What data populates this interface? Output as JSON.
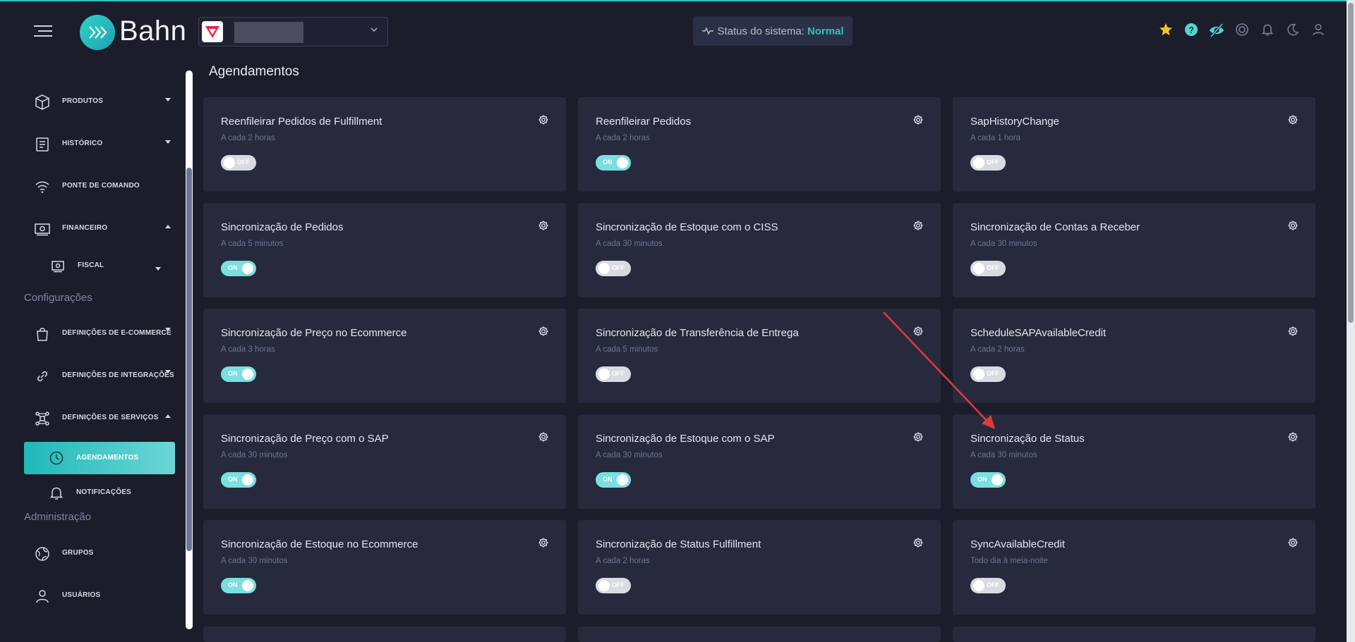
{
  "app": {
    "brand": "Bahn"
  },
  "header": {
    "status_label": "Status do sistema:",
    "status_value": "Normal",
    "icons": [
      "star-icon",
      "help-icon",
      "eye-off-icon",
      "support-icon",
      "bell-icon",
      "moon-icon",
      "user-icon"
    ],
    "colors": {
      "accent": "#2ec4b6",
      "star": "#f5c518"
    }
  },
  "sidebar": {
    "items": [
      {
        "label": "PRODUTOS",
        "icon": "box-icon",
        "caret": "down"
      },
      {
        "label": "HISTÓRICO",
        "icon": "document-icon",
        "caret": "down"
      },
      {
        "label": "PONTE DE COMANDO",
        "icon": "wifi-icon",
        "caret": ""
      },
      {
        "label": "FINANCEIRO",
        "icon": "money-icon",
        "caret": "up"
      },
      {
        "label": "FISCAL",
        "icon": "receipt-icon",
        "caret": "down"
      }
    ],
    "section_config": "Configurações",
    "config_items": [
      {
        "label": "DEFINIÇÕES DE E-COMMERCE",
        "icon": "shopping-bag-icon",
        "caret": "down"
      },
      {
        "label": "DEFINIÇÕES DE INTEGRAÇÕES",
        "icon": "link-icon",
        "caret": "down"
      },
      {
        "label": "DEFINIÇÕES DE SERVIÇOS",
        "icon": "network-icon",
        "caret": "up"
      },
      {
        "label": "AGENDAMENTOS",
        "icon": "clock-icon",
        "active": true
      },
      {
        "label": "NOTIFICAÇÕES",
        "icon": "bell-icon"
      }
    ],
    "section_admin": "Administração",
    "admin_items": [
      {
        "label": "GRUPOS",
        "icon": "globe-icon"
      },
      {
        "label": "USUÁRIOS",
        "icon": "user-icon"
      }
    ]
  },
  "main": {
    "title": "Agendamentos",
    "cards": [
      {
        "title": "Reenfileirar Pedidos de Fulfillment",
        "subtitle": "A cada 2 horas",
        "state": "OFF"
      },
      {
        "title": "Reenfileirar Pedidos",
        "subtitle": "A cada 2 horas",
        "state": "ON"
      },
      {
        "title": "SapHistoryChange",
        "subtitle": "A cada 1 hora",
        "state": "OFF"
      },
      {
        "title": "Sincronização de Pedidos",
        "subtitle": "A cada 5 minutos",
        "state": "ON"
      },
      {
        "title": "Sincronização de Estoque com o CISS",
        "subtitle": "A cada 30 minutos",
        "state": "OFF"
      },
      {
        "title": "Sincronização de Contas a Receber",
        "subtitle": "A cada 30 minutos",
        "state": "OFF"
      },
      {
        "title": "Sincronização de Preço no Ecommerce",
        "subtitle": "A cada 3 horas",
        "state": "ON"
      },
      {
        "title": "Sincronização de Transferência de Entrega",
        "subtitle": "A cada 5 minutos",
        "state": "OFF"
      },
      {
        "title": "ScheduleSAPAvailableCredit",
        "subtitle": "A cada 2 horas",
        "state": "OFF"
      },
      {
        "title": "Sincronização de Preço com o SAP",
        "subtitle": "A cada 30 minutos",
        "state": "ON"
      },
      {
        "title": "Sincronização de Estoque com o SAP",
        "subtitle": "A cada 30 minutos",
        "state": "ON"
      },
      {
        "title": "Sincronização de Status",
        "subtitle": "A cada 30 minutos",
        "state": "ON"
      },
      {
        "title": "Sincronização de Estoque no Ecommerce",
        "subtitle": "A cada 30 minutos",
        "state": "ON"
      },
      {
        "title": "Sincronização de Status Fulfillment",
        "subtitle": "A cada 2 horas",
        "state": "OFF"
      },
      {
        "title": "SyncAvailableCredit",
        "subtitle": "Todo dia à meia-noite",
        "state": "OFF"
      }
    ],
    "annotation_arrow_color": "#e03b3b"
  }
}
